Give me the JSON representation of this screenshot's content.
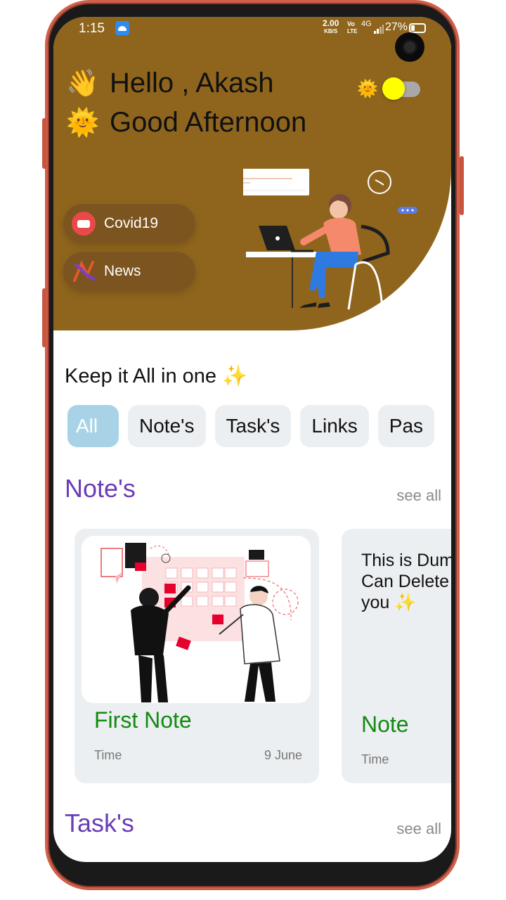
{
  "status_bar": {
    "time": "1:15",
    "net_speed_value": "2.00",
    "net_speed_unit": "KB/S",
    "volte_top": "Vo",
    "volte_bottom": "LTE",
    "network": "4G",
    "battery": "27%",
    "battery_level_percent": 27
  },
  "header": {
    "greeting_emoji": "👋",
    "greeting": "Hello , Akash",
    "time_emoji": "🌞",
    "time_greeting": "Good Afternoon",
    "toggle_emoji": "🌞",
    "toggle_on": true,
    "accent_color": "#8f651d",
    "shortcuts": [
      {
        "label": "Covid19",
        "icon": "mask-icon"
      },
      {
        "label": "News",
        "icon": "news-logo-icon"
      }
    ]
  },
  "main": {
    "tagline": "Keep it All in one ✨",
    "filters": [
      "All",
      "Note's",
      "Task's",
      "Links",
      "Pas"
    ],
    "active_filter": "All",
    "notes_section": {
      "title": "Note's",
      "see_all": "see all",
      "cards": [
        {
          "title": "First Note",
          "time_label": "Time",
          "date": "9 June"
        },
        {
          "body_line1": "This is Dum",
          "body_line2": "Can Delete",
          "body_line3": "you ✨",
          "title": "Note",
          "time_label": "Time"
        }
      ]
    },
    "tasks_section": {
      "title": "Task's",
      "see_all": "see all"
    }
  },
  "colors": {
    "section_title": "#6a3db5",
    "card_title": "#138a12",
    "active_filter": "#a8d3e6"
  }
}
